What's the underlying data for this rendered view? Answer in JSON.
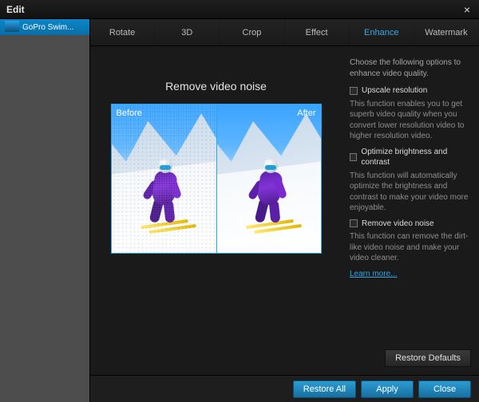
{
  "window": {
    "title": "Edit",
    "close_glyph": "×"
  },
  "sidebar": {
    "items": [
      {
        "label": "GoPro Swim..."
      }
    ]
  },
  "tabs": [
    {
      "label": "Rotate",
      "active": false
    },
    {
      "label": "3D",
      "active": false
    },
    {
      "label": "Crop",
      "active": false
    },
    {
      "label": "Effect",
      "active": false
    },
    {
      "label": "Enhance",
      "active": true
    },
    {
      "label": "Watermark",
      "active": false
    }
  ],
  "preview": {
    "title": "Remove video noise",
    "before_label": "Before",
    "after_label": "After"
  },
  "enhance": {
    "intro": "Choose the following options to enhance video quality.",
    "options": [
      {
        "label": "Upscale resolution",
        "checked": false,
        "desc": "This function enables you to get superb video quality when you convert lower resolution video to higher resolution video."
      },
      {
        "label": "Optimize brightness and contrast",
        "checked": false,
        "desc": "This function will automatically optimize the brightness and contrast to make your video more enjoyable."
      },
      {
        "label": "Remove video noise",
        "checked": false,
        "desc": "This function can remove the dirt-like video noise and make your video cleaner."
      }
    ],
    "learn_more": "Learn more..."
  },
  "buttons": {
    "restore_defaults": "Restore Defaults",
    "restore_all": "Restore All",
    "apply": "Apply",
    "close": "Close"
  }
}
